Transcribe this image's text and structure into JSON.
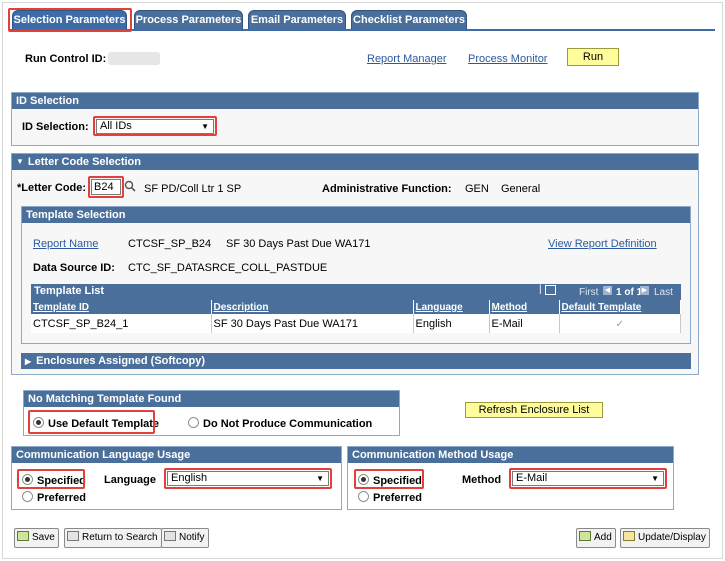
{
  "tabs": [
    "Selection Parameters",
    "Process Parameters",
    "Email Parameters",
    "Checklist Parameters"
  ],
  "header": {
    "run_control_label": "Run Control ID:",
    "report_manager": "Report Manager",
    "process_monitor": "Process Monitor",
    "run": "Run"
  },
  "id_selection": {
    "title": "ID Selection",
    "label": "ID Selection:",
    "value": "All IDs"
  },
  "letter_code_selection": {
    "title": "Letter Code Selection",
    "letter_code_label": "*Letter Code:",
    "letter_code_value": "B24",
    "letter_desc": "SF PD/Coll Ltr 1 SP",
    "admin_function_label": "Administrative Function:",
    "admin_function_code": "GEN",
    "admin_function_desc": "General"
  },
  "template_selection": {
    "title": "Template Selection",
    "report_name_link": "Report Name",
    "report_name_value": "CTCSF_SP_B24",
    "report_desc": "SF 30 Days Past Due WA171",
    "view_report_definition": "View Report Definition",
    "data_source_label": "Data Source ID:",
    "data_source_value": "CTC_SF_DATASRCE_COLL_PASTDUE"
  },
  "template_list": {
    "title": "Template List",
    "first": "First",
    "range": "1 of 1",
    "last": "Last",
    "columns": [
      "Template ID",
      "Description",
      "Language",
      "Method",
      "Default Template"
    ],
    "rows": [
      [
        "CTCSF_SP_B24_1",
        "SF 30 Days Past Due WA171",
        "English",
        "E-Mail",
        "✓"
      ]
    ]
  },
  "enclosures": {
    "title": "Enclosures Assigned (Softcopy)"
  },
  "no_matching": {
    "title": "No Matching Template Found",
    "opt1": "Use Default Template",
    "opt2": "Do Not Produce Communication"
  },
  "refresh_enclosure": "Refresh Enclosure List",
  "comm_language": {
    "title": "Communication Language Usage",
    "specified": "Specified",
    "preferred": "Preferred",
    "language_label": "Language",
    "language_value": "English"
  },
  "comm_method": {
    "title": "Communication Method Usage",
    "specified": "Specified",
    "preferred": "Preferred",
    "method_label": "Method",
    "method_value": "E-Mail"
  },
  "footer": {
    "save": "Save",
    "return_to_search": "Return to Search",
    "notify": "Notify",
    "add": "Add",
    "update_display": "Update/Display"
  }
}
